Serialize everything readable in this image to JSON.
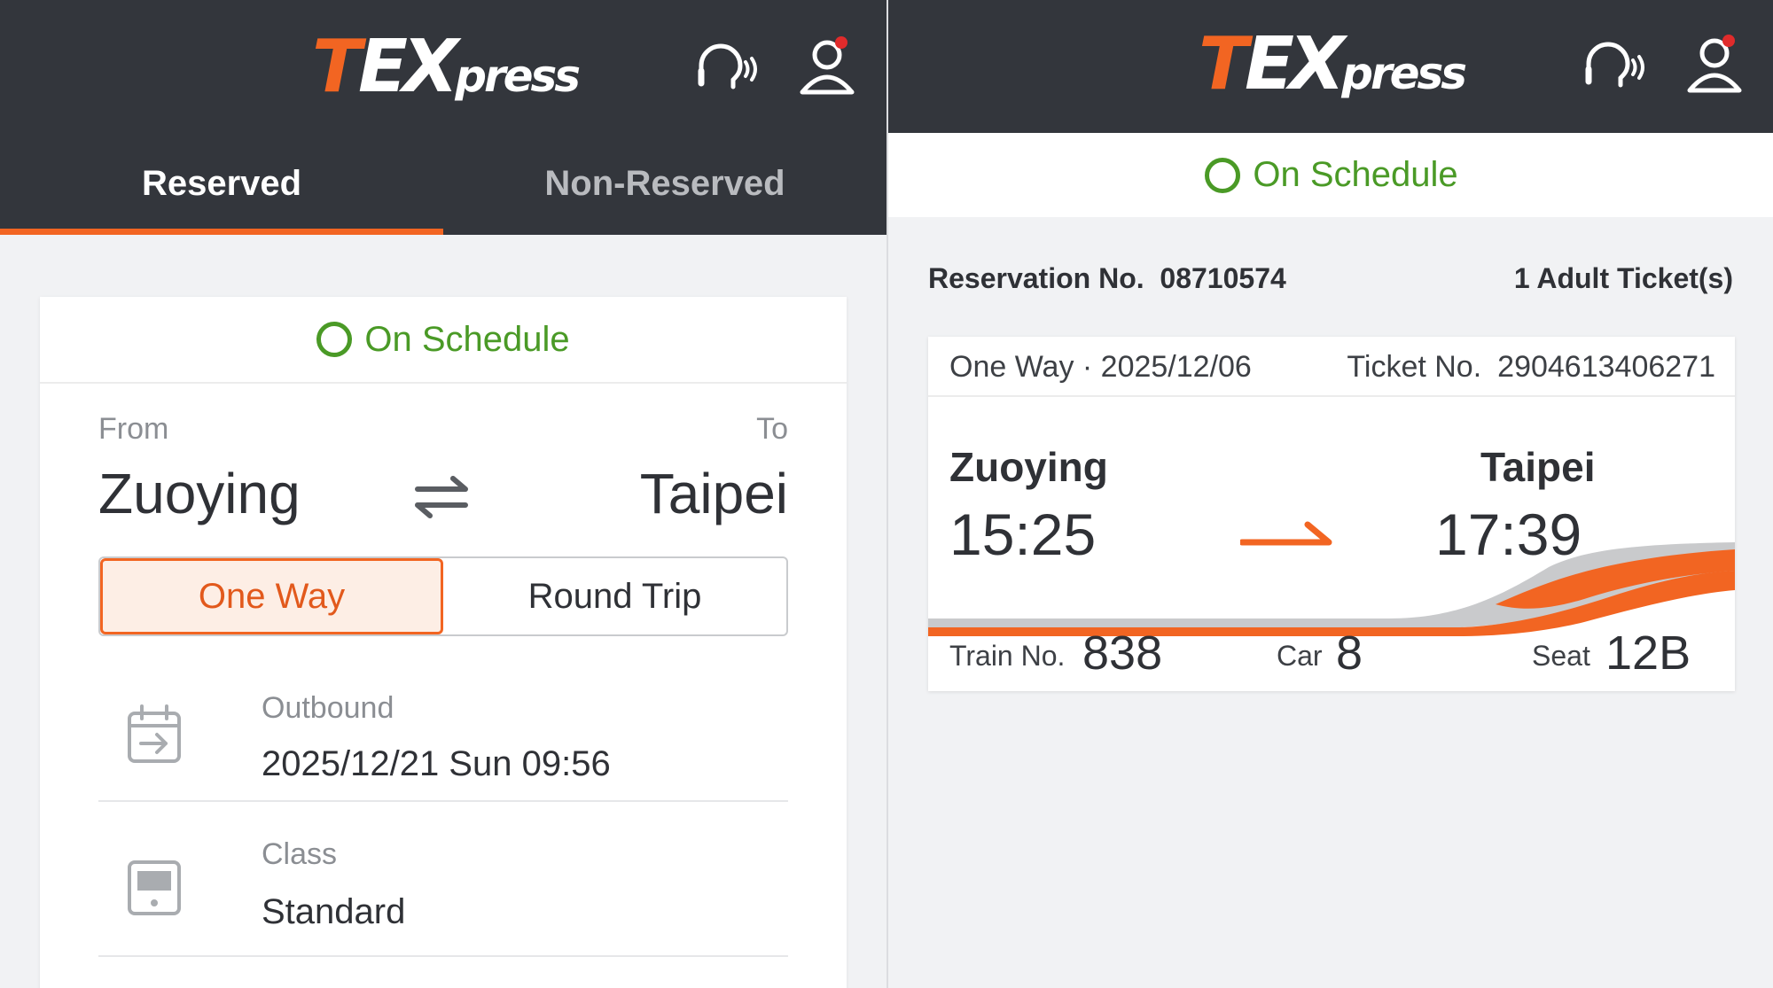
{
  "left_panel": {
    "tabs": {
      "reserved": "Reserved",
      "non_reserved": "Non-Reserved"
    },
    "status": "On Schedule",
    "route": {
      "from_label": "From",
      "to_label": "To",
      "from_station": "Zuoying",
      "to_station": "Taipei"
    },
    "trip_type": {
      "one_way": "One Way",
      "round_trip": "Round Trip",
      "selected": "One Way"
    },
    "outbound": {
      "label": "Outbound",
      "value": "2025/12/21 Sun 09:56"
    },
    "class": {
      "label": "Class",
      "value": "Standard"
    }
  },
  "right_panel": {
    "status": "On Schedule",
    "reservation_label": "Reservation No.",
    "reservation_no": "08710574",
    "tickets": "1 Adult Ticket(s)",
    "ticket": {
      "trip_date": "One Way · 2025/12/06",
      "ticket_no_label": "Ticket No.",
      "ticket_no": "2904613406271",
      "departure_station": "Zuoying",
      "departure_time": "15:25",
      "arrival_station": "Taipei",
      "arrival_time": "17:39",
      "train_no_label": "Train No.",
      "train_no": "838",
      "car_label": "Car",
      "car": "8",
      "seat_label": "Seat",
      "seat": "12B"
    }
  },
  "colors": {
    "accent": "#f26522",
    "header": "#33363c",
    "status_green": "#4a9a26"
  },
  "icons": [
    "headset-icon",
    "user-icon",
    "swap-icon",
    "calendar-icon",
    "seat-icon",
    "arrow-right-icon"
  ]
}
